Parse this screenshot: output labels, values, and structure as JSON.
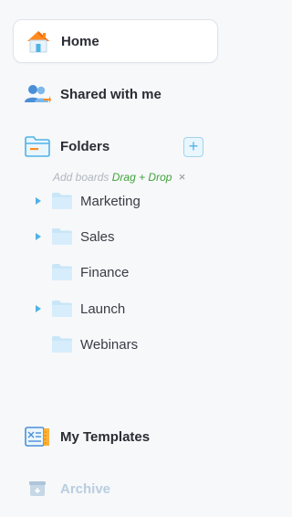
{
  "nav": {
    "home_label": "Home",
    "shared_label": "Shared with me",
    "folders_label": "Folders",
    "add_folder_symbol": "+",
    "templates_label": "My Templates",
    "archive_label": "Archive"
  },
  "hint": {
    "prefix": "Add boards",
    "action": "Drag + Drop",
    "close": "×"
  },
  "folders": [
    {
      "label": "Marketing",
      "expandable": true
    },
    {
      "label": "Sales",
      "expandable": true
    },
    {
      "label": "Finance",
      "expandable": false
    },
    {
      "label": "Launch",
      "expandable": true
    },
    {
      "label": "Webinars",
      "expandable": false
    }
  ],
  "colors": {
    "accent": "#4fb3e6",
    "folder": "#c9e6f8",
    "hint_green": "#3ea33a"
  },
  "icons": {
    "home": "home-icon",
    "shared": "shared-users-icon",
    "folders": "folder-open-icon",
    "templates": "templates-icon",
    "archive": "archive-icon",
    "caret": "caret-right-icon",
    "folder": "folder-icon"
  }
}
